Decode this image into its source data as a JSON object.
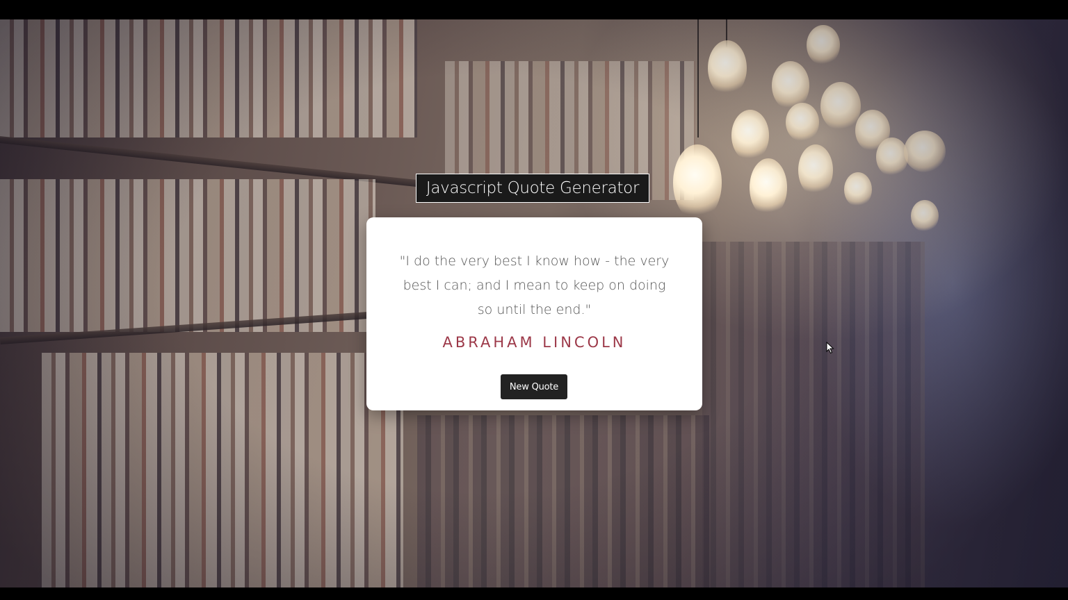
{
  "app": {
    "title": "Javascript Quote Generator"
  },
  "quote": {
    "text": "\"I do the very best I know how - the very best I can; and I mean to keep on doing so until the end.\"",
    "author": "ABRAHAM LINCOLN"
  },
  "actions": {
    "new_quote_label": "New Quote"
  },
  "background": {
    "description_icon": "library-bookshelf-photo"
  },
  "colors": {
    "title_bg": "#1a1a1a",
    "author": "#9c3848",
    "button_bg": "#222222",
    "card_bg": "#ffffff"
  }
}
